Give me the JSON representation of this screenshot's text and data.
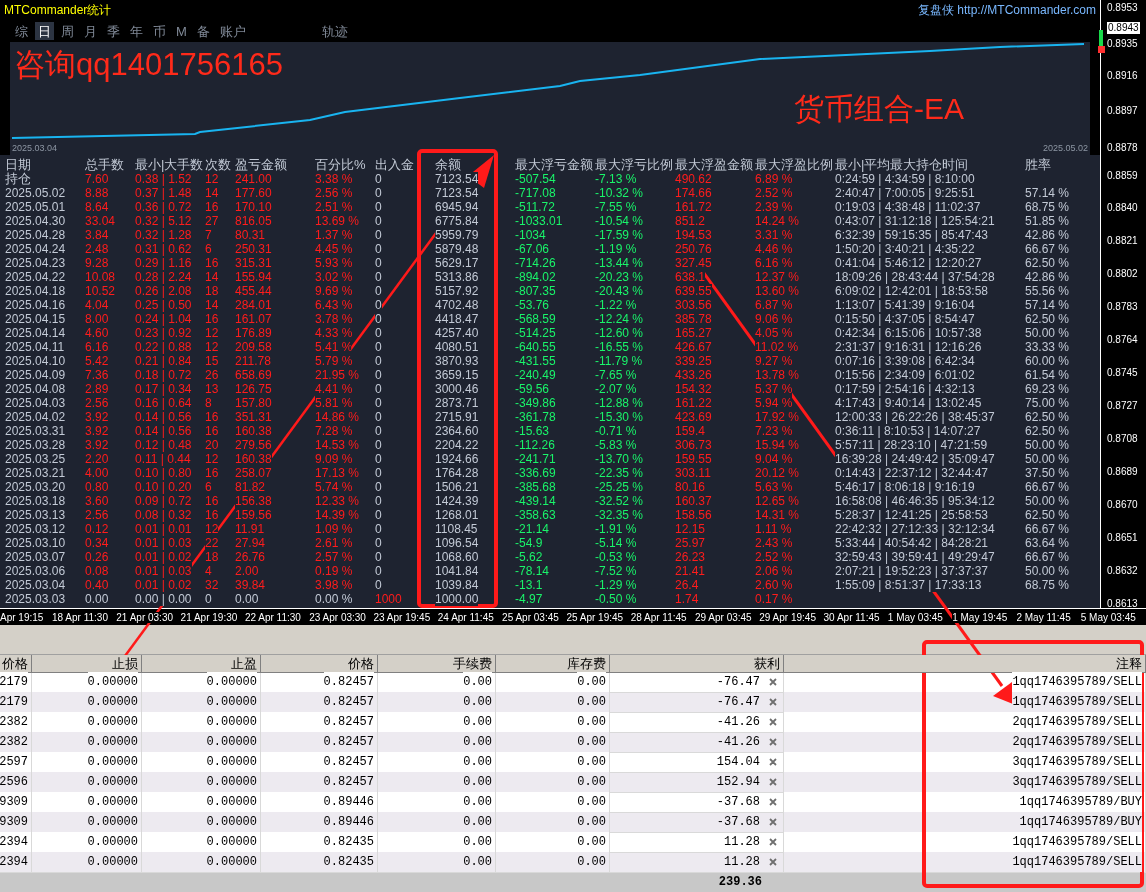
{
  "title": "MTCommander统计",
  "site_link": "复盘侠 http://MTCommander.com",
  "tabs": [
    {
      "label": "综",
      "selected": false
    },
    {
      "label": "日",
      "selected": true
    },
    {
      "label": "周",
      "selected": false
    },
    {
      "label": "月",
      "selected": false
    },
    {
      "label": "季",
      "selected": false
    },
    {
      "label": "年",
      "selected": false
    },
    {
      "label": "币",
      "selected": false
    },
    {
      "label": "M",
      "selected": false
    },
    {
      "label": "备",
      "selected": false
    },
    {
      "label": "账户",
      "selected": false
    },
    {
      "label": "轨迹",
      "selected": false
    }
  ],
  "equity_chart": {
    "start_date": "2025.03.04",
    "end_date": "2025.05.02"
  },
  "overlay_texts": [
    "咨询qq1401756165",
    "货币组合-EA"
  ],
  "stats_table": {
    "columns": [
      "日期",
      "总手数",
      "最小|大手数",
      "次数",
      "盈亏金额",
      "百分比%",
      "出入金",
      "余额",
      "最大浮亏金额",
      "最大浮亏比例",
      "最大浮盈金额",
      "最大浮盈比例",
      "最小|平均最大持仓时间",
      "胜率"
    ],
    "rows": [
      {
        "kind": "day",
        "cells": [
          "持仓",
          "7.60",
          "0.38 | 1.52",
          "12",
          "241.00",
          "3.38 %",
          "0",
          "7123.54",
          "-507.54",
          "-7.13 %",
          "490.62",
          "6.89 %",
          "0:24:59 | 4:34:59 | 8:10:00"
        ]
      },
      {
        "kind": "day",
        "cells": [
          "2025.05.02",
          "8.88",
          "0.37 | 1.48",
          "14",
          "177.60",
          "2.56 %",
          "0",
          "7123.54",
          "-717.08",
          "-10.32 %",
          "174.66",
          "2.52 %",
          "2:40:47 | 7:00:05 | 9:25:51",
          "57.14 %"
        ]
      },
      {
        "kind": "day",
        "cells": [
          "2025.05.01",
          "8.64",
          "0.36 | 0.72",
          "16",
          "170.10",
          "2.51 %",
          "0",
          "6945.94",
          "-511.72",
          "-7.55 %",
          "161.72",
          "2.39 %",
          "0:19:03 | 4:38:48 | 11:02:37",
          "68.75 %"
        ]
      },
      {
        "kind": "day",
        "cells": [
          "2025.04.30",
          "33.04",
          "0.32 | 5.12",
          "27",
          "816.05",
          "13.69 %",
          "0",
          "6775.84",
          "-1033.01",
          "-10.54 %",
          "851.2",
          "14.24 %",
          "0:43:07 | 31:12:18 | 125:54:21",
          "51.85 %"
        ]
      },
      {
        "kind": "day",
        "cells": [
          "2025.04.28",
          "3.84",
          "0.32 | 1.28",
          "7",
          "80.31",
          "1.37 %",
          "0",
          "5959.79",
          "-1034",
          "-17.59 %",
          "194.53",
          "3.31 %",
          "6:32:39 | 59:15:35 | 85:47:43",
          "42.86 %"
        ]
      },
      {
        "kind": "day",
        "cells": [
          "2025.04.24",
          "2.48",
          "0.31 | 0.62",
          "6",
          "250.31",
          "4.45 %",
          "0",
          "5879.48",
          "-67.06",
          "-1.19 %",
          "250.76",
          "4.46 %",
          "1:50:20 | 3:40:21 | 4:35:22",
          "66.67 %"
        ]
      },
      {
        "kind": "day",
        "cells": [
          "2025.04.23",
          "9.28",
          "0.29 | 1.16",
          "16",
          "315.31",
          "5.93 %",
          "0",
          "5629.17",
          "-714.26",
          "-13.44 %",
          "327.45",
          "6.16 %",
          "0:41:04 | 5:46:12 | 12:20:27",
          "62.50 %"
        ]
      },
      {
        "kind": "day",
        "cells": [
          "2025.04.22",
          "10.08",
          "0.28 | 2.24",
          "14",
          "155.94",
          "3.02 %",
          "0",
          "5313.86",
          "-894.02",
          "-20.23 %",
          "638.1",
          "12.37 %",
          "18:09:26 | 28:43:44 | 37:54:28",
          "42.86 %"
        ]
      },
      {
        "kind": "day",
        "cells": [
          "2025.04.18",
          "10.52",
          "0.26 | 2.08",
          "18",
          "455.44",
          "9.69 %",
          "0",
          "5157.92",
          "-807.35",
          "-20.43 %",
          "639.55",
          "13.60 %",
          "6:09:02 | 12:42:01 | 18:53:58",
          "55.56 %"
        ]
      },
      {
        "kind": "day",
        "cells": [
          "2025.04.16",
          "4.04",
          "0.25 | 0.50",
          "14",
          "284.01",
          "6.43 %",
          "0",
          "4702.48",
          "-53.76",
          "-1.22 %",
          "303.56",
          "6.87 %",
          "1:13:07 | 5:41:39 | 9:16:04",
          "57.14 %"
        ]
      },
      {
        "kind": "day",
        "cells": [
          "2025.04.15",
          "8.00",
          "0.24 | 1.04",
          "16",
          "161.07",
          "3.78 %",
          "0",
          "4418.47",
          "-568.59",
          "-12.24 %",
          "385.78",
          "9.06 %",
          "0:15:50 | 4:37:05 | 8:54:47",
          "62.50 %"
        ]
      },
      {
        "kind": "day",
        "cells": [
          "2025.04.14",
          "4.60",
          "0.23 | 0.92",
          "12",
          "176.89",
          "4.33 %",
          "0",
          "4257.40",
          "-514.25",
          "-12.60 %",
          "165.27",
          "4.05 %",
          "0:42:34 | 6:15:06 | 10:57:38",
          "50.00 %"
        ]
      },
      {
        "kind": "day",
        "cells": [
          "2025.04.11",
          "6.16",
          "0.22 | 0.88",
          "12",
          "209.58",
          "5.41 %",
          "0",
          "4080.51",
          "-640.55",
          "-16.55 %",
          "426.67",
          "11.02 %",
          "2:31:37 | 9:16:31 | 12:16:26",
          "33.33 %"
        ]
      },
      {
        "kind": "day",
        "cells": [
          "2025.04.10",
          "5.42",
          "0.21 | 0.84",
          "15",
          "211.78",
          "5.79 %",
          "0",
          "3870.93",
          "-431.55",
          "-11.79 %",
          "339.25",
          "9.27 %",
          "0:07:16 | 3:39:08 | 6:42:34",
          "60.00 %"
        ]
      },
      {
        "kind": "day",
        "cells": [
          "2025.04.09",
          "7.36",
          "0.18 | 0.72",
          "26",
          "658.69",
          "21.95 %",
          "0",
          "3659.15",
          "-240.49",
          "-7.65 %",
          "433.26",
          "13.78 %",
          "0:15:56 | 2:34:09 | 6:01:02",
          "61.54 %"
        ]
      },
      {
        "kind": "day",
        "cells": [
          "2025.04.08",
          "2.89",
          "0.17 | 0.34",
          "13",
          "126.75",
          "4.41 %",
          "0",
          "3000.46",
          "-59.56",
          "-2.07 %",
          "154.32",
          "5.37 %",
          "0:17:59 | 2:54:16 | 4:32:13",
          "69.23 %"
        ]
      },
      {
        "kind": "day",
        "cells": [
          "2025.04.03",
          "2.56",
          "0.16 | 0.64",
          "8",
          "157.80",
          "5.81 %",
          "0",
          "2873.71",
          "-349.86",
          "-12.88 %",
          "161.22",
          "5.94 %",
          "4:17:43 | 9:40:14 | 13:02:45",
          "75.00 %"
        ]
      },
      {
        "kind": "day",
        "cells": [
          "2025.04.02",
          "3.92",
          "0.14 | 0.56",
          "16",
          "351.31",
          "14.86 %",
          "0",
          "2715.91",
          "-361.78",
          "-15.30 %",
          "423.69",
          "17.92 %",
          "12:00:33 | 26:22:26 | 38:45:37",
          "62.50 %"
        ]
      },
      {
        "kind": "day",
        "cells": [
          "2025.03.31",
          "3.92",
          "0.14 | 0.56",
          "16",
          "160.38",
          "7.28 %",
          "0",
          "2364.60",
          "-15.63",
          "-0.71 %",
          "159.4",
          "7.23 %",
          "0:36:11 | 8:10:53 | 14:07:27",
          "62.50 %"
        ]
      },
      {
        "kind": "day",
        "cells": [
          "2025.03.28",
          "3.92",
          "0.12 | 0.48",
          "20",
          "279.56",
          "14.53 %",
          "0",
          "2204.22",
          "-112.26",
          "-5.83 %",
          "306.73",
          "15.94 %",
          "5:57:11 | 28:23:10 | 47:21:59",
          "50.00 %"
        ]
      },
      {
        "kind": "day",
        "cells": [
          "2025.03.25",
          "2.20",
          "0.11 | 0.44",
          "12",
          "160.38",
          "9.09 %",
          "0",
          "1924.66",
          "-241.71",
          "-13.70 %",
          "159.55",
          "9.04 %",
          "16:39:28 | 24:49:42 | 35:09:47",
          "50.00 %"
        ]
      },
      {
        "kind": "day",
        "cells": [
          "2025.03.21",
          "4.00",
          "0.10 | 0.80",
          "16",
          "258.07",
          "17.13 %",
          "0",
          "1764.28",
          "-336.69",
          "-22.35 %",
          "303.11",
          "20.12 %",
          "0:14:43 | 22:37:12 | 32:44:47",
          "37.50 %"
        ]
      },
      {
        "kind": "day",
        "cells": [
          "2025.03.20",
          "0.80",
          "0.10 | 0.20",
          "6",
          "81.82",
          "5.74 %",
          "0",
          "1506.21",
          "-385.68",
          "-25.25 %",
          "80.16",
          "5.63 %",
          "5:46:17 | 8:06:18 | 9:16:19",
          "66.67 %"
        ]
      },
      {
        "kind": "day",
        "cells": [
          "2025.03.18",
          "3.60",
          "0.09 | 0.72",
          "16",
          "156.38",
          "12.33 %",
          "0",
          "1424.39",
          "-439.14",
          "-32.52 %",
          "160.37",
          "12.65 %",
          "16:58:08 | 46:46:35 | 95:34:12",
          "50.00 %"
        ]
      },
      {
        "kind": "day",
        "cells": [
          "2025.03.13",
          "2.56",
          "0.08 | 0.32",
          "16",
          "159.56",
          "14.39 %",
          "0",
          "1268.01",
          "-358.63",
          "-32.35 %",
          "158.56",
          "14.31 %",
          "5:28:37 | 12:41:25 | 25:58:53",
          "62.50 %"
        ]
      },
      {
        "kind": "day",
        "cells": [
          "2025.03.12",
          "0.12",
          "0.01 | 0.01",
          "12",
          "11.91",
          "1.09 %",
          "0",
          "1108.45",
          "-21.14",
          "-1.91 %",
          "12.15",
          "1.11 %",
          "22:42:32 | 27:12:33 | 32:12:34",
          "66.67 %"
        ]
      },
      {
        "kind": "day",
        "cells": [
          "2025.03.10",
          "0.34",
          "0.01 | 0.03",
          "22",
          "27.94",
          "2.61 %",
          "0",
          "1096.54",
          "-54.9",
          "-5.14 %",
          "25.97",
          "2.43 %",
          "5:33:44 | 40:54:42 | 84:28:21",
          "63.64 %"
        ]
      },
      {
        "kind": "day",
        "cells": [
          "2025.03.07",
          "0.26",
          "0.01 | 0.02",
          "18",
          "26.76",
          "2.57 %",
          "0",
          "1068.60",
          "-5.62",
          "-0.53 %",
          "26.23",
          "2.52 %",
          "32:59:43 | 39:59:41 | 49:29:47",
          "66.67 %"
        ]
      },
      {
        "kind": "day",
        "cells": [
          "2025.03.06",
          "0.08",
          "0.01 | 0.03",
          "4",
          "2.00",
          "0.19 %",
          "0",
          "1041.84",
          "-78.14",
          "-7.52 %",
          "21.41",
          "2.06 %",
          "2:07:21 | 19:52:23 | 37:37:37",
          "50.00 %"
        ]
      },
      {
        "kind": "day",
        "cells": [
          "2025.03.04",
          "0.40",
          "0.01 | 0.02",
          "32",
          "39.84",
          "3.98 %",
          "0",
          "1039.84",
          "-13.1",
          "-1.29 %",
          "26.4",
          "2.60 %",
          "1:55:09 | 8:51:37 | 17:33:13",
          "68.75 %"
        ]
      },
      {
        "kind": "deposit",
        "cells": [
          "2025.03.03",
          "0.00",
          "0.00 | 0.00",
          "0",
          "0.00",
          "0.00 %",
          "1000",
          "1000.00",
          "-4.97",
          "-0.50 %",
          "1.74",
          "0.17 %"
        ]
      }
    ]
  },
  "price_axis": [
    {
      "label": "0.8953",
      "current": false
    },
    {
      "label": "0.8943",
      "current": true
    },
    {
      "label": "0.8935",
      "current": false
    },
    {
      "label": "0.8916",
      "current": false
    },
    {
      "label": "0.8897",
      "current": false
    },
    {
      "label": "0.8878",
      "current": false
    },
    {
      "label": "0.8859",
      "current": false
    },
    {
      "label": "0.8840",
      "current": false
    },
    {
      "label": "0.8821",
      "current": false
    },
    {
      "label": "0.8802",
      "current": false
    },
    {
      "label": "0.8783",
      "current": false
    },
    {
      "label": "0.8764",
      "current": false
    },
    {
      "label": "0.8745",
      "current": false
    },
    {
      "label": "0.8727",
      "current": false
    },
    {
      "label": "0.8708",
      "current": false
    },
    {
      "label": "0.8689",
      "current": false
    },
    {
      "label": "0.8670",
      "current": false
    },
    {
      "label": "0.8651",
      "current": false
    },
    {
      "label": "0.8632",
      "current": false
    },
    {
      "label": "0.8613",
      "current": false
    }
  ],
  "time_axis": [
    "Apr 19:15",
    "18 Apr 11:30",
    "21 Apr 03:30",
    "21 Apr 19:30",
    "22 Apr 11:30",
    "23 Apr 03:30",
    "23 Apr 19:45",
    "24 Apr 11:45",
    "25 Apr 03:45",
    "25 Apr 19:45",
    "28 Apr 11:45",
    "29 Apr 03:45",
    "29 Apr 19:45",
    "30 Apr 11:45",
    "1 May 03:45",
    "1 May 19:45",
    "2 May 11:45",
    "5 May 03:45"
  ],
  "positions_table": {
    "columns": [
      "价格",
      "止损",
      "止盈",
      "价格",
      "手续费",
      "库存费",
      "获利",
      "注释"
    ],
    "rows": [
      {
        "cells": [
          "2179",
          "0.00000",
          "0.00000",
          "0.82457",
          "0.00",
          "0.00",
          "-76.47",
          "1qq1746395789/SELL"
        ]
      },
      {
        "cells": [
          "2179",
          "0.00000",
          "0.00000",
          "0.82457",
          "0.00",
          "0.00",
          "-76.47",
          "1qq1746395789/SELL"
        ]
      },
      {
        "cells": [
          "2382",
          "0.00000",
          "0.00000",
          "0.82457",
          "0.00",
          "0.00",
          "-41.26",
          "2qq1746395789/SELL"
        ]
      },
      {
        "cells": [
          "2382",
          "0.00000",
          "0.00000",
          "0.82457",
          "0.00",
          "0.00",
          "-41.26",
          "2qq1746395789/SELL"
        ]
      },
      {
        "cells": [
          "2597",
          "0.00000",
          "0.00000",
          "0.82457",
          "0.00",
          "0.00",
          "154.04",
          "3qq1746395789/SELL"
        ]
      },
      {
        "cells": [
          "2596",
          "0.00000",
          "0.00000",
          "0.82457",
          "0.00",
          "0.00",
          "152.94",
          "3qq1746395789/SELL"
        ]
      },
      {
        "cells": [
          "9309",
          "0.00000",
          "0.00000",
          "0.89446",
          "0.00",
          "0.00",
          "-37.68",
          "1qq1746395789/BUY"
        ]
      },
      {
        "cells": [
          "9309",
          "0.00000",
          "0.00000",
          "0.89446",
          "0.00",
          "0.00",
          "-37.68",
          "1qq1746395789/BUY"
        ]
      },
      {
        "cells": [
          "2394",
          "0.00000",
          "0.00000",
          "0.82435",
          "0.00",
          "0.00",
          "11.28",
          "1qq1746395789/SELL"
        ]
      },
      {
        "cells": [
          "2394",
          "0.00000",
          "0.00000",
          "0.82435",
          "0.00",
          "0.00",
          "11.28",
          "1qq1746395789/SELL"
        ]
      }
    ],
    "total_profit": "239.36"
  }
}
